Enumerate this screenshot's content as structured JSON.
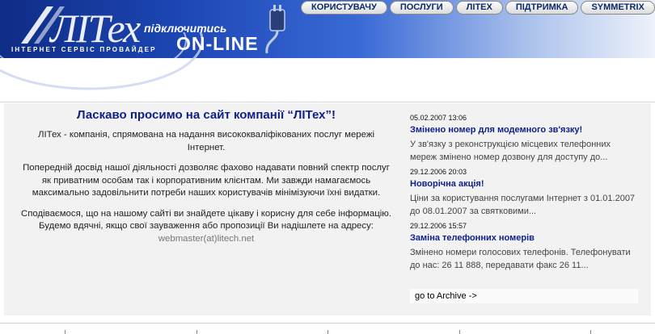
{
  "header": {
    "logo": "ЛІТех",
    "tagline": "ІНТЕРНЕТ СЕРВІС ПРОВАЙДЕР",
    "connect_small": "підключитись",
    "connect_big": "ON-LINE",
    "nav": [
      "КОРИСТУВАЧУ",
      "ПОСЛУГИ",
      "ЛІТЕХ",
      "ПІДТРИМКА",
      "SYMMETRIX"
    ]
  },
  "welcome": {
    "title": "Ласкаво просимо на сайт компанії “ЛІТех”!",
    "p1": "ЛІТех - компанія, спрямована на надання висококваліфікованих послуг мережі Інтернет.",
    "p2": "Попередній досвід нашої діяльності дозволяє фахово надавати повний спектр послуг як приватним особам так і корпоративним клієнтам. Ми завжди намагаємось максимально задовільнити потреби наших користувачів мінімізуючи їхні видатки.",
    "p3": "Сподіваємося, що на нашому сайті ви знайдете цікаву і корисну для себе інформацію. Будемо вдячні, якщо свої зауваження або пропозиції Ви надішлете на адресу: ",
    "email": "webmaster(at)litech.net"
  },
  "news": [
    {
      "date": "05.02.2007 13:06",
      "title": "Змінено номер для модемного зв'язку!",
      "text": "У зв'язку з реконструкцією місцевих телефонних мереж змінено номер дозвону для доступу до..."
    },
    {
      "date": "29.12.2006 20:03",
      "title": "Новорічна акція!",
      "text": "Ціни за користування послугами Інтернет з 01.01.2007 до 08.01.2007 за святковими..."
    },
    {
      "date": "29.12.2006 15:57",
      "title": "Заміна телефонних номерів",
      "text": "Змінено номери голосових телефонів. Телефонувати до нас: 26 11 888, передавати факс 26 11..."
    }
  ],
  "archive_link": "go to Archive ->",
  "colors": {
    "title_blue": "#0f1f8a",
    "banner_dark": "#0f2c86",
    "content_bg": "#f2f2f2"
  }
}
